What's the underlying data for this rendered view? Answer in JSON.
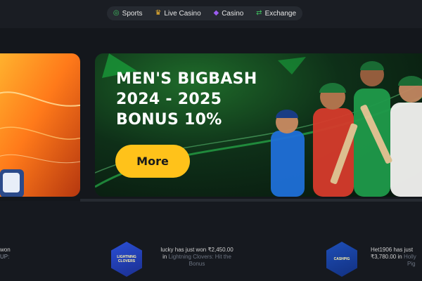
{
  "nav": {
    "items": [
      {
        "label": "Sports",
        "icon": "sports-icon"
      },
      {
        "label": "Live Casino",
        "icon": "live-casino-icon"
      },
      {
        "label": "Casino",
        "icon": "casino-icon"
      },
      {
        "label": "Exchange",
        "icon": "exchange-icon"
      }
    ]
  },
  "banner": {
    "title_lines": [
      "MEN'S BIGBASH",
      "2024 - 2025",
      "BONUS 10%"
    ],
    "button_label": "More"
  },
  "ticker": {
    "left_partial": {
      "line1": "won",
      "line2": "UP:"
    },
    "items": [
      {
        "line1": "lucky has just won ₹2,450.00",
        "in_word": "in",
        "game": "Lightning Clovers: Hit the",
        "game_tail": "Bonus",
        "badge_text": "LIGHTNING CLOVERS"
      },
      {
        "line1": "Het1906 has just",
        "amount": "₹3,780.00",
        "in_word": "in",
        "game": "Holly",
        "game_tail": "Pig",
        "badge_text": "CASHPIG"
      }
    ]
  },
  "colors": {
    "page_bg": "#16191f",
    "accent_button": "#ffc21a",
    "nav_pill": "#262a31",
    "banner_green": "#1f6b2a",
    "side_banner_orange": "#ff7a1a"
  }
}
